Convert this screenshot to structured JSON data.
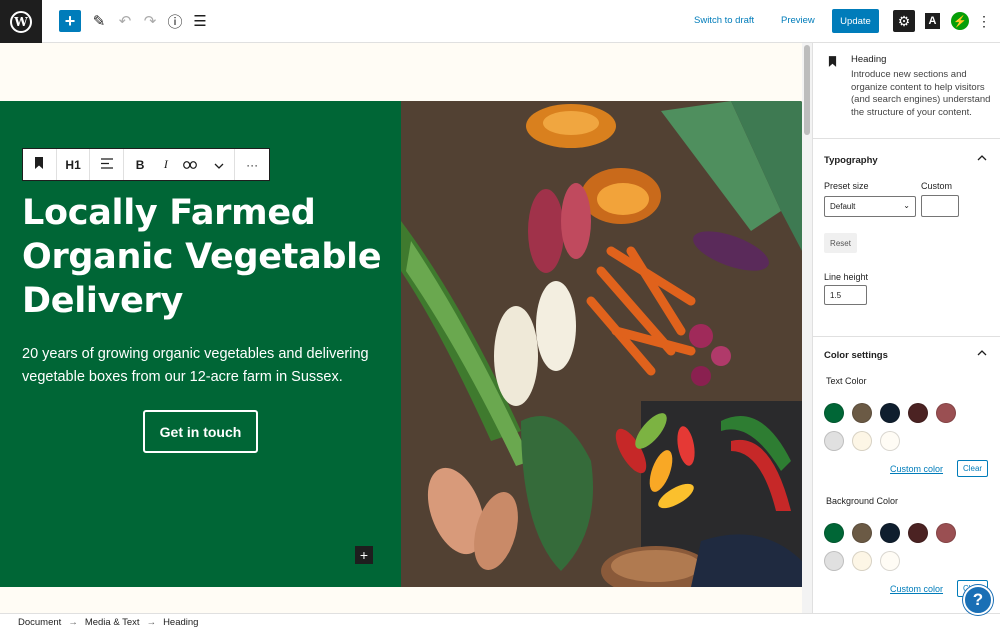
{
  "toolbar": {
    "logo_letter": "W",
    "add_icon": "plus-icon",
    "switch_to_draft": "Switch to draft",
    "preview": "Preview",
    "update": "Update",
    "a_label": "A"
  },
  "block_toolbar": {
    "heading_level": "H1",
    "bold": "B",
    "italic": "I"
  },
  "hero": {
    "heading": "Locally Farmed Organic Vegetable Delivery",
    "text": "20 years of growing organic vegetables and delivering vegetable boxes from our 12-acre farm in Sussex.",
    "button": "Get in touch"
  },
  "breadcrumb": {
    "items": [
      "Document",
      "Media & Text",
      "Heading"
    ]
  },
  "sidebar": {
    "block": {
      "title": "Heading",
      "description": "Introduce new sections and organize content to help visitors (and search engines) understand the structure of your content."
    },
    "typography": {
      "title": "Typography",
      "preset_label": "Preset size",
      "preset_value": "Default",
      "custom_label": "Custom",
      "reset": "Reset",
      "line_height_label": "Line height",
      "line_height_value": "1.5"
    },
    "color": {
      "title": "Color settings",
      "text_color_label": "Text Color",
      "background_color_label": "Background Color",
      "custom_color": "Custom color",
      "clear": "Clear",
      "palette": [
        "#006636",
        "#6b5a45",
        "#0f1e2e",
        "#4b2222",
        "#9a4f52",
        "#e0e0e0",
        "#fdf6e6",
        "#fffcf5"
      ]
    }
  },
  "colors": {
    "accent": "#007cba",
    "hero_bg": "#006636",
    "canvas_bg": "#fffcf5"
  }
}
